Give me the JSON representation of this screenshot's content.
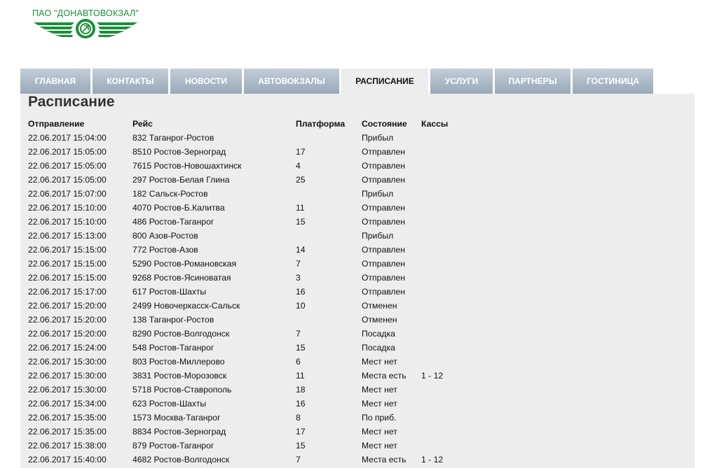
{
  "brand": {
    "name": "ПАО \"ДОНАВТОВОКЗАЛ\"",
    "logo_color": "#1b8f3a"
  },
  "nav": {
    "tabs": [
      {
        "label": "ГЛАВНАЯ",
        "active": false
      },
      {
        "label": "КОНТАКТЫ",
        "active": false
      },
      {
        "label": "НОВОСТИ",
        "active": false
      },
      {
        "label": "АВТОВОКЗАЛЫ",
        "active": false
      },
      {
        "label": "РАСПИСАНИЕ",
        "active": true
      },
      {
        "label": "УСЛУГИ",
        "active": false
      },
      {
        "label": "ПАРТНЕРЫ",
        "active": false
      },
      {
        "label": "ГОСТИНИЦА",
        "active": false
      }
    ]
  },
  "main": {
    "title": "Расписание",
    "columns": [
      "Отправление",
      "Рейс",
      "Платформа",
      "Состояние",
      "Кассы"
    ],
    "rows": [
      [
        "22.06.2017 15:04:00",
        "832 Таганрог-Ростов",
        "",
        "Прибыл",
        ""
      ],
      [
        "22.06.2017 15:05:00",
        "8510 Ростов-Зерноград",
        "17",
        "Отправлен",
        ""
      ],
      [
        "22.06.2017 15:05:00",
        "7615 Ростов-Новошахтинск",
        "4",
        "Отправлен",
        ""
      ],
      [
        "22.06.2017 15:05:00",
        "297 Ростов-Белая Глина",
        "25",
        "Отправлен",
        ""
      ],
      [
        "22.06.2017 15:07:00",
        "182 Сальск-Ростов",
        "",
        "Прибыл",
        ""
      ],
      [
        "22.06.2017 15:10:00",
        "4070 Ростов-Б.Калитва",
        "11",
        "Отправлен",
        ""
      ],
      [
        "22.06.2017 15:10:00",
        "486 Ростов-Таганрог",
        "15",
        "Отправлен",
        ""
      ],
      [
        "22.06.2017 15:13:00",
        "800 Азов-Ростов",
        "",
        "Прибыл",
        ""
      ],
      [
        "22.06.2017 15:15:00",
        "772 Ростов-Азов",
        "14",
        "Отправлен",
        ""
      ],
      [
        "22.06.2017 15:15:00",
        "5290 Ростов-Романовская",
        "7",
        "Отправлен",
        ""
      ],
      [
        "22.06.2017 15:15:00",
        "9268 Ростов-Ясиноватая",
        "3",
        "Отправлен",
        ""
      ],
      [
        "22.06.2017 15:17:00",
        "617 Ростов-Шахты",
        "16",
        "Отправлен",
        ""
      ],
      [
        "22.06.2017 15:20:00",
        "2499 Новочеркасск-Сальск",
        "10",
        "Отменен",
        ""
      ],
      [
        "22.06.2017 15:20:00",
        "138 Таганрог-Ростов",
        "",
        "Отменен",
        ""
      ],
      [
        "22.06.2017 15:20:00",
        "8290 Ростов-Волгодонск",
        "7",
        "Посадка",
        ""
      ],
      [
        "22.06.2017 15:24:00",
        "548 Ростов-Таганрог",
        "15",
        "Посадка",
        ""
      ],
      [
        "22.06.2017 15:30:00",
        "803 Ростов-Миллерово",
        "6",
        "Мест нет",
        ""
      ],
      [
        "22.06.2017 15:30:00",
        "3831 Ростов-Морозовск",
        "11",
        "Места есть",
        "1 - 12"
      ],
      [
        "22.06.2017 15:30:00",
        "5718 Ростов-Ставрополь",
        "18",
        "Мест нет",
        ""
      ],
      [
        "22.06.2017 15:34:00",
        "623 Ростов-Шахты",
        "16",
        "Мест нет",
        ""
      ],
      [
        "22.06.2017 15:35:00",
        "1573 Москва-Таганрог",
        "8",
        "По приб.",
        ""
      ],
      [
        "22.06.2017 15:35:00",
        "8834 Ростов-Зерноград",
        "17",
        "Мест нет",
        ""
      ],
      [
        "22.06.2017 15:38:00",
        "879 Ростов-Таганрог",
        "15",
        "Мест нет",
        ""
      ],
      [
        "22.06.2017 15:40:00",
        "4682 Ростов-Волгодонск",
        "7",
        "Места есть",
        "1 - 12"
      ]
    ]
  }
}
